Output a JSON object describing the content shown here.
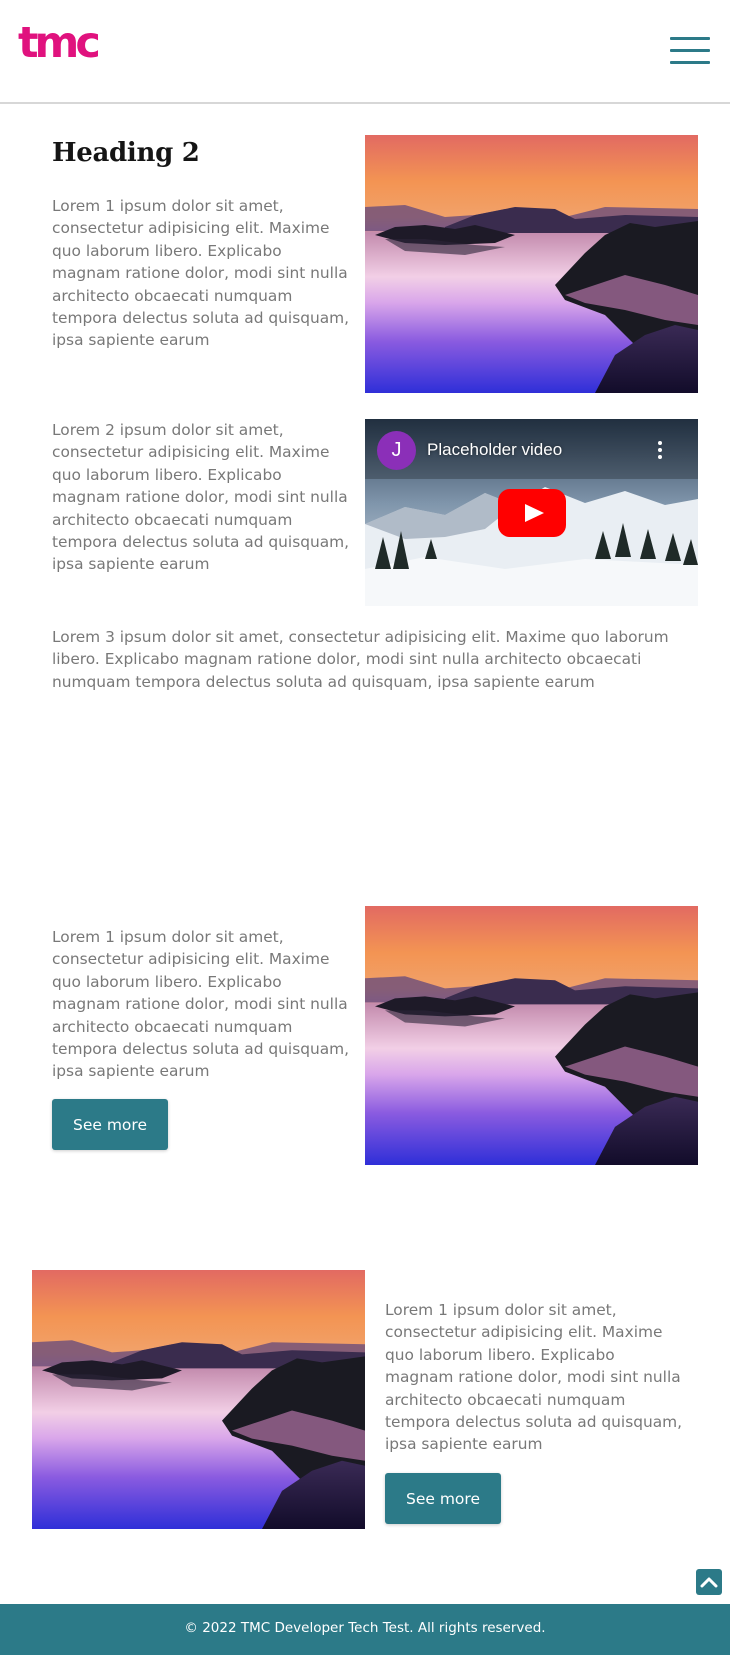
{
  "header": {
    "logo_text": "tmc",
    "menu_icon": "hamburger-menu-icon",
    "brand_color": "#e0127e",
    "accent_color": "#2c7a88"
  },
  "section1": {
    "heading": "Heading 2",
    "text": "Lorem 1 ipsum dolor sit amet, consectetur adipisicing elit. Maxime quo laborum libero. Explicabo magnam ratione dolor, modi sint nulla architecto obcaecati numquam tempora delectus soluta ad quisquam, ipsa sapiente earum"
  },
  "section2": {
    "text": "Lorem 2 ipsum dolor sit amet, consectetur adipisicing elit. Maxime quo laborum libero. Explicabo magnam ratione dolor, modi sint nulla architecto obcaecati numquam tempora delectus soluta ad quisquam, ipsa sapiente earum",
    "video": {
      "channel_initial": "J",
      "title": "Placeholder video",
      "play_icon": "youtube-play-icon",
      "more_icon": "more-vertical-icon"
    }
  },
  "section3": {
    "text": "Lorem 3 ipsum dolor sit amet, consectetur adipisicing elit. Maxime quo laborum libero. Explicabo magnam ratione dolor, modi sint nulla architecto obcaecati numquam tempora delectus soluta ad quisquam, ipsa sapiente earum"
  },
  "section4": {
    "text": "Lorem 1 ipsum dolor sit amet, consectetur adipisicing elit. Maxime quo laborum libero. Explicabo magnam ratione dolor, modi sint nulla architecto obcaecati numquam tempora delectus soluta ad quisquam, ipsa sapiente earum",
    "button_label": "See more"
  },
  "section5": {
    "text": "Lorem 1 ipsum dolor sit amet, consectetur adipisicing elit. Maxime quo laborum libero. Explicabo magnam ratione dolor, modi sint nulla architecto obcaecati numquam tempora delectus soluta ad quisquam, ipsa sapiente earum",
    "button_label": "See more"
  },
  "back_to_top_icon": "chevron-up-icon",
  "footer": {
    "text": "© 2022 TMC Developer Tech Test. All rights reserved."
  }
}
